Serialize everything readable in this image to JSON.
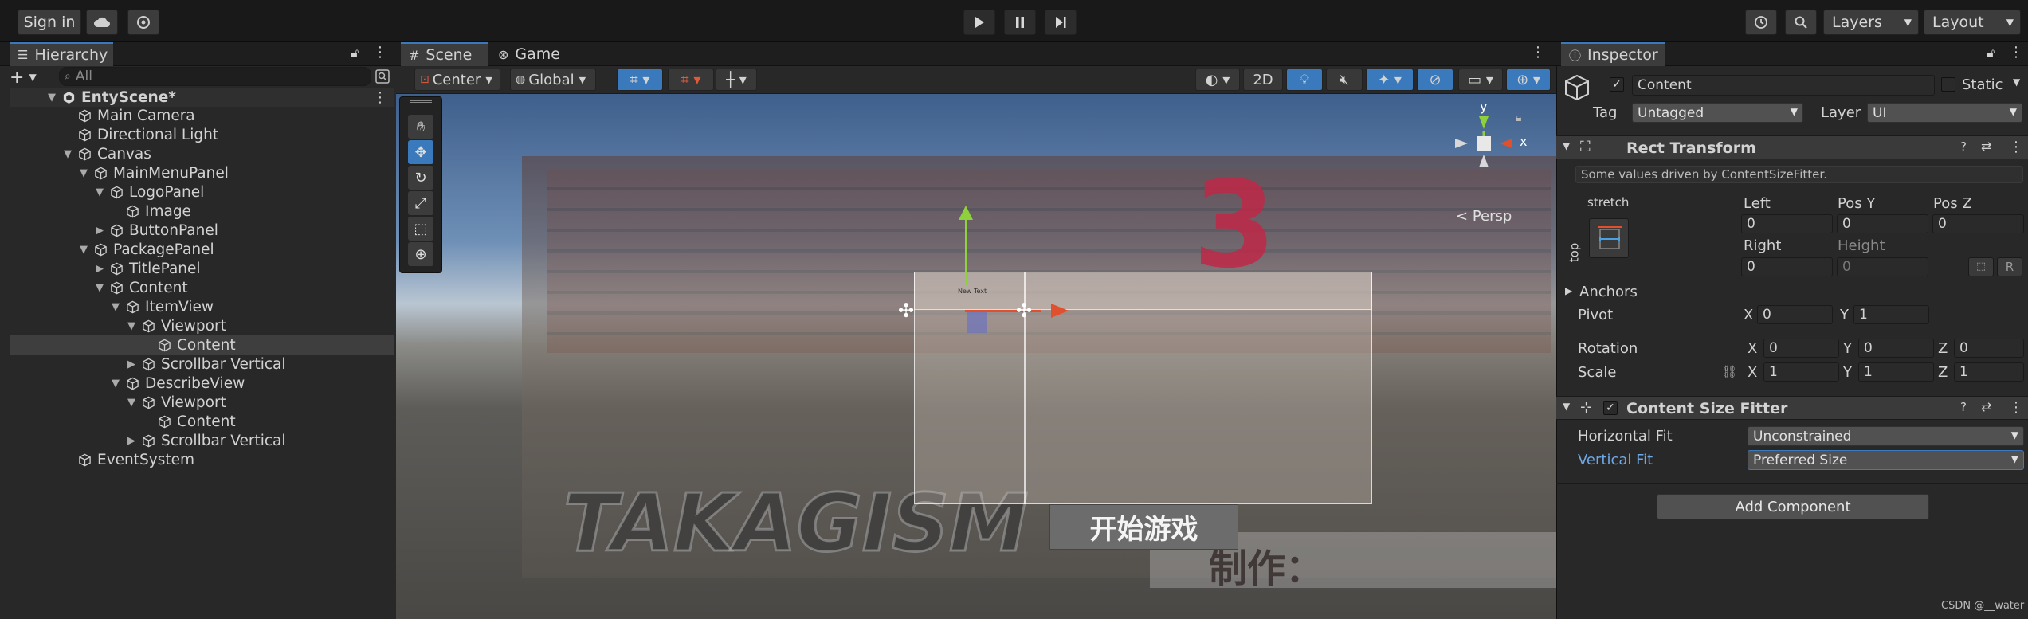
{
  "toolbar": {
    "sign_in": "Sign in",
    "layers": "Layers",
    "layout": "Layout"
  },
  "hierarchy": {
    "tab": "Hierarchy",
    "search_placeholder": "All",
    "scene": "EntyScene*",
    "items": [
      {
        "label": "Main Camera"
      },
      {
        "label": "Directional Light"
      },
      {
        "label": "Canvas"
      },
      {
        "label": "MainMenuPanel"
      },
      {
        "label": "LogoPanel"
      },
      {
        "label": "Image"
      },
      {
        "label": "ButtonPanel"
      },
      {
        "label": "PackagePanel"
      },
      {
        "label": "TitlePanel"
      },
      {
        "label": "Content"
      },
      {
        "label": "ItemView"
      },
      {
        "label": "Viewport"
      },
      {
        "label": "Content"
      },
      {
        "label": "Scrollbar Vertical"
      },
      {
        "label": "DescribeView"
      },
      {
        "label": "Viewport"
      },
      {
        "label": "Content"
      },
      {
        "label": "Scrollbar Vertical"
      },
      {
        "label": "EventSystem"
      }
    ]
  },
  "scene_view": {
    "tab_scene": "Scene",
    "tab_game": "Game",
    "pivot_mode": "Center",
    "pivot_space": "Global",
    "mode_2d": "2D",
    "persp": "Persp",
    "gizmo_y": "y",
    "gizmo_x": "x",
    "start_button_text": "开始游戏",
    "credit_text": "制作：",
    "logo_text": "TAKAGISM",
    "logo_number": "3",
    "new_text": "New Text"
  },
  "inspector": {
    "tab": "Inspector",
    "object_name": "Content",
    "static_label": "Static",
    "tag_label": "Tag",
    "tag_value": "Untagged",
    "layer_label": "Layer",
    "layer_value": "UI",
    "rect_transform": {
      "title": "Rect Transform",
      "note": "Some values driven by ContentSizeFitter.",
      "anchor_top": "stretch",
      "anchor_side": "top",
      "left_label": "Left",
      "left": "0",
      "posy_label": "Pos Y",
      "posy": "0",
      "posz_label": "Pos Z",
      "posz": "0",
      "right_label": "Right",
      "right": "0",
      "height_label": "Height",
      "height": "0",
      "anchors_label": "Anchors",
      "pivot_label": "Pivot",
      "pivot_x": "0",
      "pivot_y": "1",
      "rotation_label": "Rotation",
      "rot_x": "0",
      "rot_y": "0",
      "rot_z": "0",
      "scale_label": "Scale",
      "scale_x": "1",
      "scale_y": "1",
      "scale_z": "1",
      "x": "X",
      "y": "Y",
      "z": "Z",
      "r": "R"
    },
    "content_size_fitter": {
      "title": "Content Size Fitter",
      "horizontal_label": "Horizontal Fit",
      "horizontal_value": "Unconstrained",
      "vertical_label": "Vertical Fit",
      "vertical_value": "Preferred Size"
    },
    "add_component": "Add Component"
  },
  "watermark": "CSDN @__water"
}
